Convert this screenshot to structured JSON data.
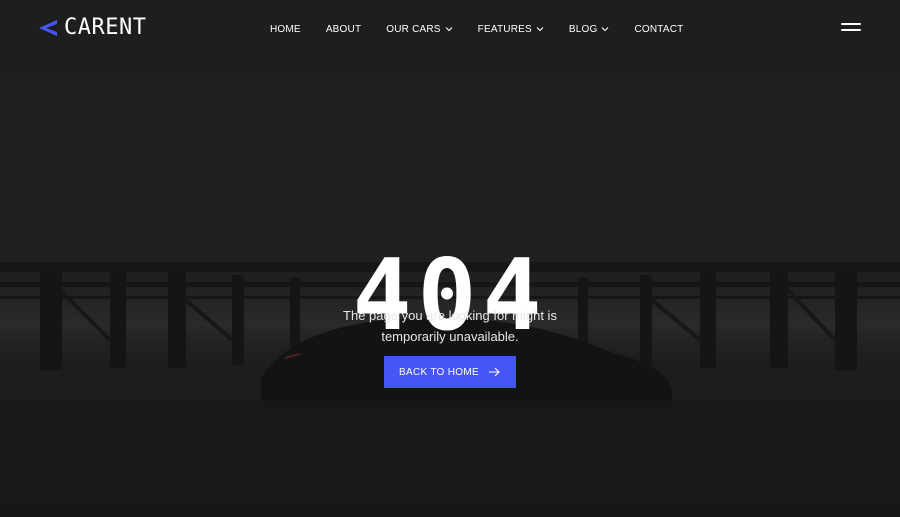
{
  "brand": {
    "name": "CARENT",
    "icon": "chevron-left-logo-mark",
    "accent_color": "#4656f5"
  },
  "nav": {
    "items": [
      {
        "label": "HOME",
        "has_dropdown": false
      },
      {
        "label": "ABOUT",
        "has_dropdown": false
      },
      {
        "label": "OUR CARS",
        "has_dropdown": true
      },
      {
        "label": "FEATURES",
        "has_dropdown": true
      },
      {
        "label": "BLOG",
        "has_dropdown": true
      },
      {
        "label": "CONTACT",
        "has_dropdown": false
      }
    ],
    "menu_icon": "hamburger-menu-icon"
  },
  "error": {
    "code": "404",
    "message": "The page you are looking for might is temporarily unavailable."
  },
  "cta": {
    "label": "BACK TO HOME",
    "icon": "arrow-right-icon"
  },
  "colors": {
    "background": "#1b1c1c",
    "text": "#ffffff",
    "button": "#4656f5"
  }
}
